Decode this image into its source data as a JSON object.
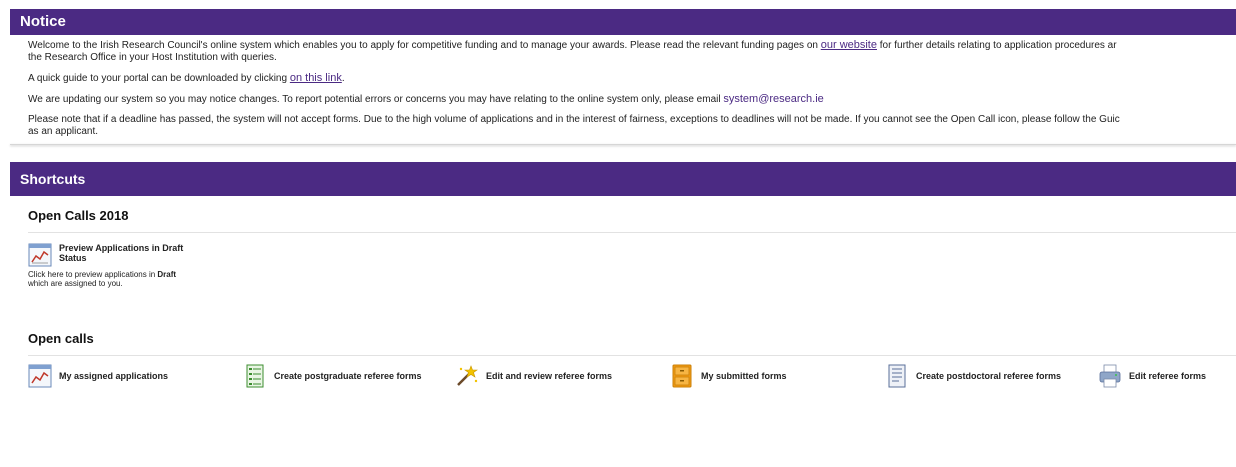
{
  "notice": {
    "title": "Notice",
    "p1_a": "Welcome to the Irish Research Council's online system which enables you to apply for competitive funding and to manage your awards. Please read the relevant funding pages on ",
    "p1_link": "our website",
    "p1_b": " for further details relating to application procedures ar",
    "p1_line2": "the Research Office in your Host Institution with queries.",
    "p2_a": "A quick guide to your portal can be downloaded by clicking ",
    "p2_link": "on this link",
    "p2_b": ".",
    "p3_a": "We are updating our system so you may notice changes. To report potential errors or concerns you may have relating to the online system only, please email ",
    "p3_email": "system@research.ie",
    "p4_line1": "Please note that if a deadline has passed, the system will not accept forms. Due to the high volume of applications and in the interest of fairness, exceptions to deadlines will not be made. If you cannot see the Open Call icon, please follow the Guic",
    "p4_line2": "as an applicant."
  },
  "shortcuts": {
    "title": "Shortcuts",
    "section1_title": "Open Calls 2018",
    "preview": {
      "label": "Preview Applications in Draft Status",
      "desc_a": "Click here to preview applications in ",
      "desc_bold": "Draft",
      "desc_b": "which are assigned to you."
    },
    "section2_title": "Open calls",
    "items": [
      {
        "label": "My assigned applications",
        "icon": "chart-report-icon"
      },
      {
        "label": "Create postgraduate referee forms",
        "icon": "green-form-icon"
      },
      {
        "label": "Edit and review referee forms",
        "icon": "magic-wand-icon"
      },
      {
        "label": "My submitted forms",
        "icon": "orange-cabinet-icon"
      },
      {
        "label": "Create postdoctoral referee forms",
        "icon": "blue-form-icon"
      },
      {
        "label": "Edit referee forms",
        "icon": "printer-icon"
      }
    ]
  }
}
